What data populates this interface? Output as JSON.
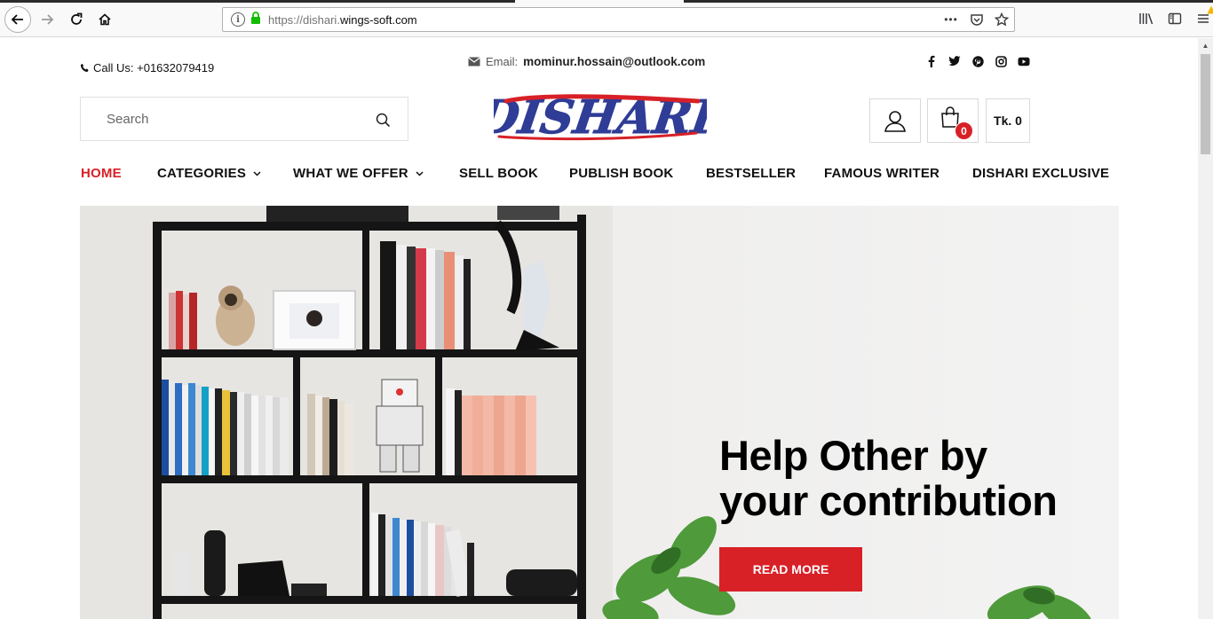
{
  "browser": {
    "url_prefix": "https://dishari.",
    "url_domain": "wings-soft.com",
    "more_label": "•••"
  },
  "topbar": {
    "call_label": "Call Us: +01632079419",
    "email_label": "Email:",
    "email_value": "mominur.hossain@outlook.com",
    "socials": [
      "facebook-icon",
      "twitter-icon",
      "pinterest-icon",
      "instagram-icon",
      "youtube-icon"
    ]
  },
  "search": {
    "placeholder": "Search"
  },
  "logo": {
    "text": "DISHARI"
  },
  "cart": {
    "count": "0",
    "total": "Tk. 0"
  },
  "nav": {
    "items": [
      {
        "label": "HOME",
        "active": true
      },
      {
        "label": "CATEGORIES",
        "dropdown": true
      },
      {
        "label": "WHAT WE OFFER",
        "dropdown": true
      },
      {
        "label": "SELL BOOK"
      },
      {
        "label": "PUBLISH BOOK"
      },
      {
        "label": "BESTSELLER"
      },
      {
        "label": "FAMOUS WRITER"
      },
      {
        "label": "DISHARI EXCLUSIVE"
      }
    ]
  },
  "hero": {
    "title_line1": "Help Other by",
    "title_line2": "your contribution",
    "button_label": "READ MORE"
  },
  "colors": {
    "accent": "#d82027",
    "logo_blue": "#2f3d96"
  }
}
